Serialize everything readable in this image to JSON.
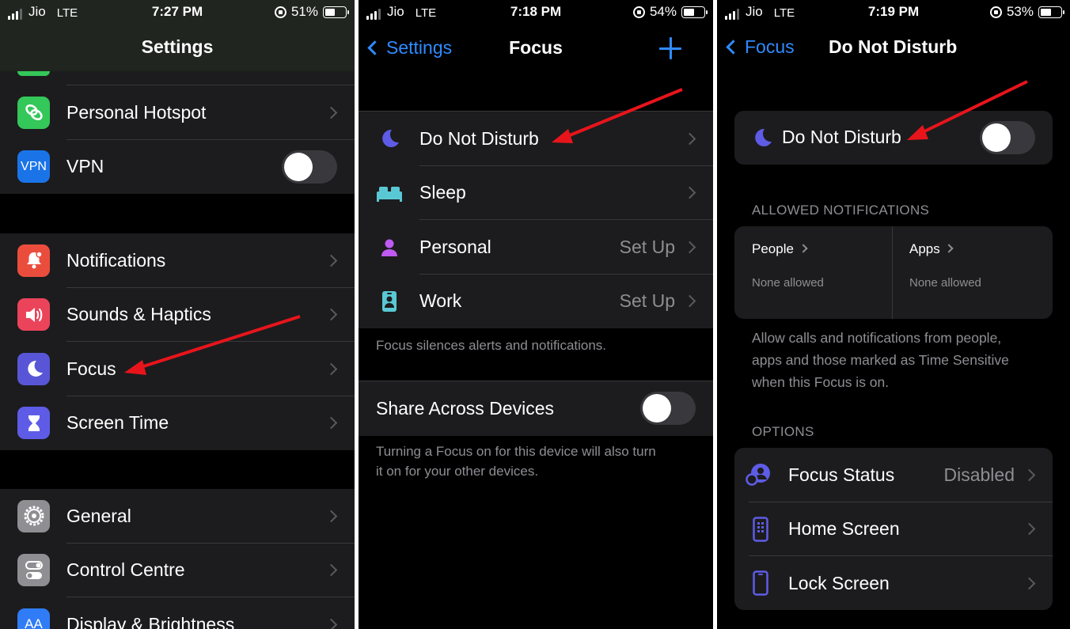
{
  "panel1": {
    "status": {
      "carrier": "Jio",
      "network": "LTE",
      "time": "7:27 PM",
      "battery": "51%",
      "battery_level": 0.51
    },
    "title": "Settings",
    "group1": [
      {
        "label": "Personal Hotspot",
        "icon": "link-icon",
        "color": "#34c759"
      },
      {
        "label": "VPN",
        "icon": "vpn-icon",
        "color": "#1a74e8",
        "icon_text": "VPN",
        "toggle": false
      }
    ],
    "group2": [
      {
        "label": "Notifications",
        "icon": "bell-icon",
        "color": "#eb4d3d"
      },
      {
        "label": "Sounds & Haptics",
        "icon": "speaker-icon",
        "color": "#eb445a"
      },
      {
        "label": "Focus",
        "icon": "moon-icon",
        "color": "#5856d6"
      },
      {
        "label": "Screen Time",
        "icon": "hourglass-icon",
        "color": "#5e5ce6"
      }
    ],
    "group3": [
      {
        "label": "General",
        "icon": "gear-icon",
        "color": "#8e8e93"
      },
      {
        "label": "Control Centre",
        "icon": "switches-icon",
        "color": "#8e8e93"
      },
      {
        "label": "Display & Brightness",
        "icon": "display-icon",
        "color": "#2f7cf6",
        "icon_text": "AA"
      }
    ]
  },
  "panel2": {
    "status": {
      "carrier": "Jio",
      "network": "LTE",
      "time": "7:18 PM",
      "battery": "54%",
      "battery_level": 0.54
    },
    "back": "Settings",
    "title": "Focus",
    "rows": [
      {
        "label": "Do Not Disturb",
        "icon": "moon-icon",
        "value": ""
      },
      {
        "label": "Sleep",
        "icon": "bed-icon",
        "value": ""
      },
      {
        "label": "Personal",
        "icon": "person-icon",
        "value": "Set Up"
      },
      {
        "label": "Work",
        "icon": "badge-icon",
        "value": "Set Up"
      }
    ],
    "footer1": "Focus silences alerts and notifications.",
    "share_label": "Share Across Devices",
    "share_toggle": false,
    "footer2_line1": "Turning a Focus on for this device will also turn",
    "footer2_line2": "it on for your other devices."
  },
  "panel3": {
    "status": {
      "carrier": "Jio",
      "network": "LTE",
      "time": "7:19 PM",
      "battery": "53%",
      "battery_level": 0.53
    },
    "back": "Focus",
    "title": "Do Not Disturb",
    "dnd_label": "Do Not Disturb",
    "dnd_toggle": false,
    "allowed_header": "ALLOWED NOTIFICATIONS",
    "people_label": "People",
    "people_value": "None allowed",
    "apps_label": "Apps",
    "apps_value": "None allowed",
    "allow_line1": "Allow calls and notifications from people,",
    "allow_line2": "apps and those marked as Time Sensitive",
    "allow_line3": "when this Focus is on.",
    "options_header": "OPTIONS",
    "options": [
      {
        "label": "Focus Status",
        "icon": "focus-status-icon",
        "value": "Disabled"
      },
      {
        "label": "Home Screen",
        "icon": "home-screen-icon",
        "value": ""
      },
      {
        "label": "Lock Screen",
        "icon": "lock-screen-icon",
        "value": ""
      }
    ]
  },
  "colors": {
    "accent": "#2f8bff",
    "arrow": "#e8141b",
    "focus_purple": "#5e5ce6"
  }
}
